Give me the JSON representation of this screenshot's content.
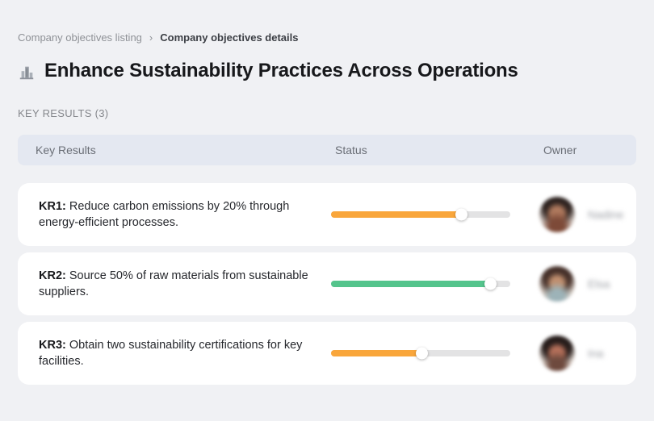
{
  "breadcrumb": {
    "parent": "Company objectives listing",
    "separator": "›",
    "current": "Company objectives details"
  },
  "header": {
    "title_icon": "buildings-icon",
    "title": "Enhance Sustainability Practices Across Operations",
    "section_label": "KEY RESULTS (3)"
  },
  "table": {
    "headers": {
      "key_results": "Key Results",
      "status": "Status",
      "owner": "Owner"
    }
  },
  "rows": [
    {
      "label": "KR1:",
      "text": "Reduce carbon emissions by 20% through energy-efficient processes.",
      "progress": 73,
      "progress_color": "#F9A63B",
      "owner": "Nadine"
    },
    {
      "label": "KR2:",
      "text": "Source 50% of raw materials from sustainable suppliers.",
      "progress": 89,
      "progress_color": "#54C48C",
      "owner": "Elsa"
    },
    {
      "label": "KR3:",
      "text": "Obtain two sustainability certifications for key facilities.",
      "progress": 51,
      "progress_color": "#F9A63B",
      "owner": "Ina"
    }
  ],
  "colors": {
    "page_background": "#F0F1F4",
    "table_header_background": "#E4E8F1",
    "card_background": "#FFFFFF",
    "progress_track": "#E3E3E4",
    "progress_orange": "#F9A63B",
    "progress_green": "#54C48C"
  }
}
